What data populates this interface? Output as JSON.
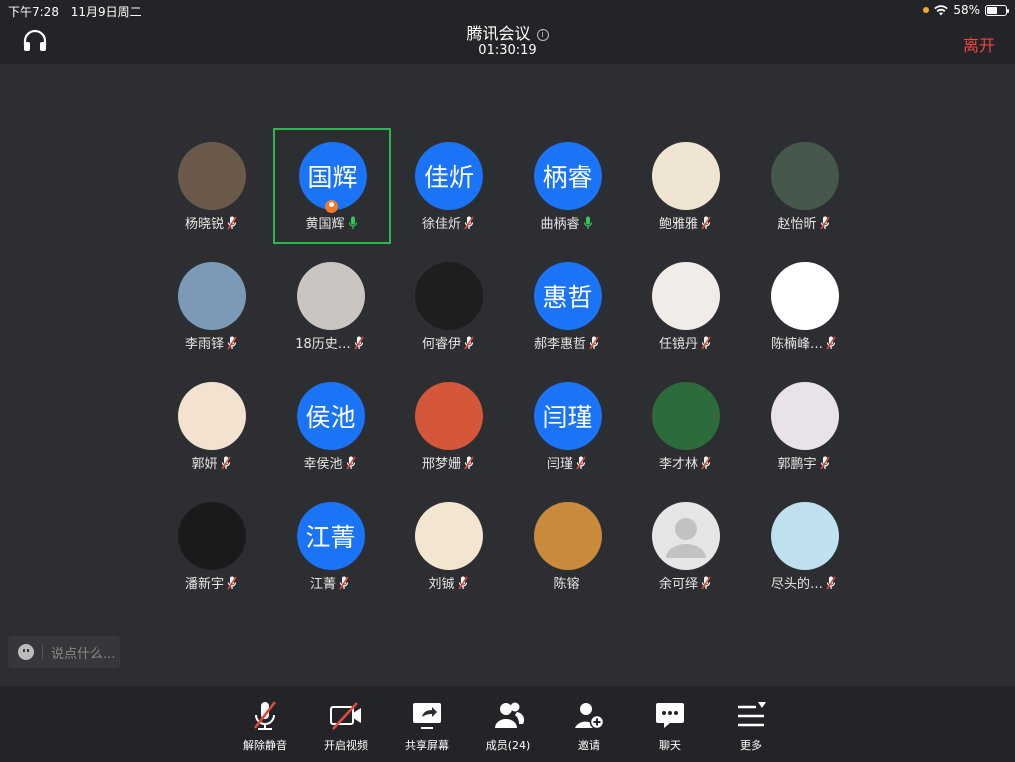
{
  "status": {
    "time": "下午7:28",
    "date": "11月9日周二",
    "battery": "58%",
    "battery_level": 0.58
  },
  "header": {
    "title": "腾讯会议",
    "timer": "01:30:19",
    "leave_label": "离开"
  },
  "participants": [
    {
      "name": "杨晓锐",
      "avatar_text": "",
      "mic": "muted",
      "avatar_color": "#6b5a4a"
    },
    {
      "name": "黄国辉",
      "avatar_text": "国辉",
      "mic": "on",
      "active": true,
      "host": true
    },
    {
      "name": "徐佳炘",
      "avatar_text": "佳炘",
      "mic": "muted"
    },
    {
      "name": "曲柄睿",
      "avatar_text": "柄睿",
      "mic": "on"
    },
    {
      "name": "鲍雅雅",
      "avatar_text": "",
      "mic": "muted",
      "avatar_color": "#efe4d2"
    },
    {
      "name": "赵怡昕",
      "avatar_text": "",
      "mic": "muted",
      "avatar_color": "#46584c"
    },
    {
      "name": "李雨铎",
      "avatar_text": "",
      "mic": "muted",
      "avatar_color": "#7a9ab5"
    },
    {
      "name": "18历史…",
      "avatar_text": "",
      "mic": "muted",
      "avatar_color": "#c9c6c2"
    },
    {
      "name": "何睿伊",
      "avatar_text": "",
      "mic": "muted",
      "avatar_color": "#1e1e1e"
    },
    {
      "name": "郝李惠哲",
      "avatar_text": "惠哲",
      "mic": "muted"
    },
    {
      "name": "任镜丹",
      "avatar_text": "",
      "mic": "muted",
      "avatar_color": "#f1ece8"
    },
    {
      "name": "陈楠峰…",
      "avatar_text": "",
      "mic": "muted",
      "avatar_color": "#ffffff"
    },
    {
      "name": "郭妍",
      "avatar_text": "",
      "mic": "muted",
      "avatar_color": "#f2e2cf"
    },
    {
      "name": "幸侯池",
      "avatar_text": "侯池",
      "mic": "muted"
    },
    {
      "name": "邢梦姗",
      "avatar_text": "",
      "mic": "muted",
      "avatar_color": "#d4573a"
    },
    {
      "name": "闫瑾",
      "avatar_text": "闫瑾",
      "mic": "muted"
    },
    {
      "name": "李才林",
      "avatar_text": "",
      "mic": "muted",
      "avatar_color": "#2e6b3c"
    },
    {
      "name": "郭鹏宇",
      "avatar_text": "",
      "mic": "muted",
      "avatar_color": "#e8e3e8"
    },
    {
      "name": "潘新宇",
      "avatar_text": "",
      "mic": "muted",
      "avatar_color": "#1a1a1a"
    },
    {
      "name": "江菁",
      "avatar_text": "江菁",
      "mic": "muted"
    },
    {
      "name": "刘铖",
      "avatar_text": "",
      "mic": "muted",
      "avatar_color": "#f3e6d0"
    },
    {
      "name": "陈镕",
      "avatar_text": "",
      "mic": "none",
      "avatar_color": "#c98a3e"
    },
    {
      "name": "余可绎",
      "avatar_text": "",
      "mic": "muted",
      "avatar_color": "#e6e6e6"
    },
    {
      "name": "尽头的…",
      "avatar_text": "",
      "mic": "muted",
      "avatar_color": "#bfe0ee"
    }
  ],
  "chat": {
    "placeholder": "说点什么..."
  },
  "toolbar": [
    {
      "label": "解除静音",
      "icon": "mic-muted-icon"
    },
    {
      "label": "开启视频",
      "icon": "video-off-icon"
    },
    {
      "label": "共享屏幕",
      "icon": "share-screen-icon"
    },
    {
      "label": "成员(24)",
      "icon": "members-icon"
    },
    {
      "label": "邀请",
      "icon": "invite-icon"
    },
    {
      "label": "聊天",
      "icon": "chat-icon"
    },
    {
      "label": "更多",
      "icon": "more-icon"
    }
  ],
  "colors": {
    "avatar_blue": "#1a74f5",
    "leave_red": "#f0483e",
    "active_green": "#2db84d",
    "mic_on": "#35c759",
    "mic_muted": "#e0483e"
  }
}
